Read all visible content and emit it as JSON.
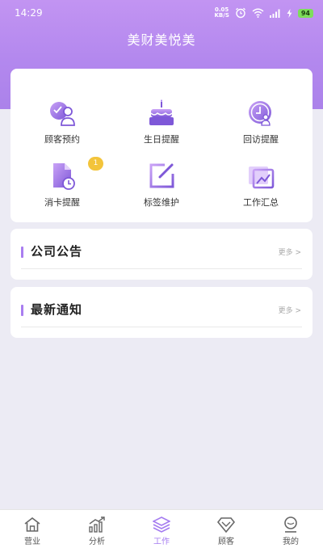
{
  "status_bar": {
    "time": "14:29",
    "net_speed_value": "0.05",
    "net_speed_unit": "KB/S",
    "battery": "94"
  },
  "app": {
    "title": "美财美悦美"
  },
  "grid": {
    "items": [
      {
        "label": "顾客预约",
        "icon": "customer-appointment-icon"
      },
      {
        "label": "生日提醒",
        "icon": "birthday-cake-icon"
      },
      {
        "label": "回访提醒",
        "icon": "return-visit-clock-icon"
      },
      {
        "label": "消卡提醒",
        "icon": "card-consumption-icon"
      },
      {
        "label": "标签维护",
        "icon": "tag-edit-icon"
      },
      {
        "label": "工作汇总",
        "icon": "work-summary-icon"
      }
    ],
    "card_badge_count": "1"
  },
  "sections": {
    "announcement": {
      "title": "公司公告",
      "more": "更多 >"
    },
    "notice": {
      "title": "最新通知",
      "more": "更多 >"
    }
  },
  "tabbar": {
    "tabs": [
      {
        "label": "营业",
        "icon": "home-icon"
      },
      {
        "label": "分析",
        "icon": "analysis-chart-icon"
      },
      {
        "label": "工作",
        "icon": "layers-icon"
      },
      {
        "label": "顾客",
        "icon": "diamond-icon"
      },
      {
        "label": "我的",
        "icon": "user-avatar-icon"
      }
    ],
    "active_index": 2
  },
  "colors": {
    "accent": "#a97ef0",
    "header_top": "#c294f2",
    "background": "#ecebf4",
    "badge": "#f3c43b"
  }
}
